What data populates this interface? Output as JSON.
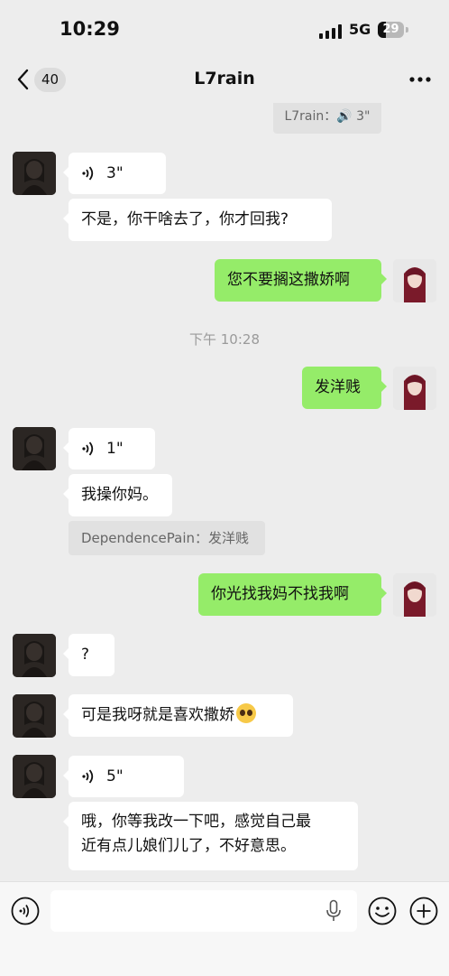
{
  "status": {
    "time": "10:29",
    "network": "5G",
    "battery": "29"
  },
  "nav": {
    "unread_count": "40",
    "title": "L7rain"
  },
  "top_quote": "L7rain：🔊 3\"",
  "messages": [
    {
      "side": "left",
      "voice": "3\""
    },
    {
      "side": "left",
      "text": "不是，你干啥去了，你才回我?"
    },
    {
      "side": "right",
      "text": "您不要搁这撒娇啊"
    },
    {
      "timestamp": "下午 10:28"
    },
    {
      "side": "right",
      "text": "发洋贱"
    },
    {
      "side": "left",
      "voice": "1\""
    },
    {
      "side": "left",
      "text": "我操你妈。"
    },
    {
      "quote": "DependencePain：发洋贱"
    },
    {
      "side": "right",
      "text": "你光找我妈不找我啊"
    },
    {
      "side": "left",
      "text": "?"
    },
    {
      "side": "left",
      "text": "可是我呀就是喜欢撒娇"
    },
    {
      "side": "left",
      "voice": "5\""
    },
    {
      "side": "left",
      "text_line1": "哦，你等我改一下吧，感觉自己最",
      "text_line2": "近有点儿娘们儿了，不好意思。"
    }
  ],
  "icons": {
    "back": "chevron-left-icon",
    "more": "more-dots-icon",
    "voice": "voice-wave-icon",
    "mic": "microphone-icon",
    "emoji": "smiley-icon",
    "plus": "plus-icon"
  },
  "colors": {
    "bubble_right": "#95ec69",
    "bubble_left": "#ffffff",
    "background": "#ededed"
  }
}
